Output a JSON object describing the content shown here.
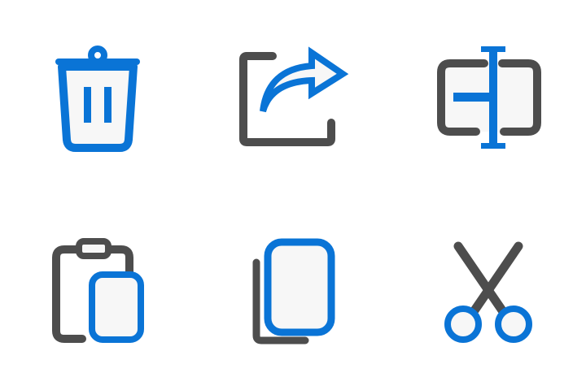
{
  "colors": {
    "accent": "#0a74d6",
    "dark": "#4d4d4d",
    "fill": "#f7f7f7",
    "background": "#ffffff"
  },
  "icons": [
    {
      "id": "delete",
      "name": "trash-icon"
    },
    {
      "id": "share",
      "name": "share-icon"
    },
    {
      "id": "rename",
      "name": "rename-icon"
    },
    {
      "id": "paste",
      "name": "paste-icon"
    },
    {
      "id": "copy",
      "name": "copy-icon"
    },
    {
      "id": "cut",
      "name": "cut-icon"
    }
  ]
}
